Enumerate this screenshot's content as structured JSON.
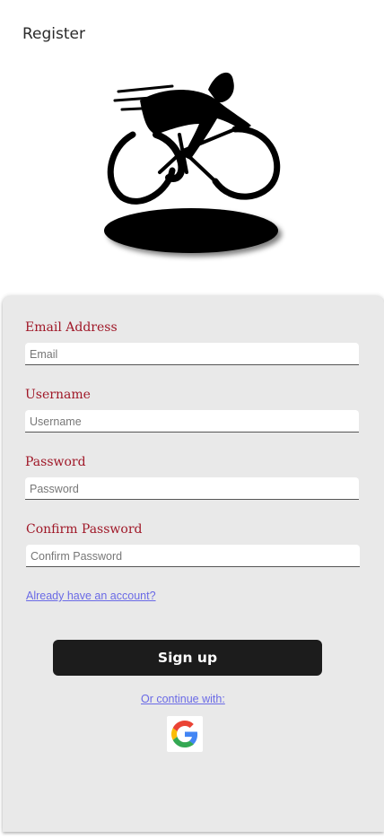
{
  "header": {
    "title": "Register"
  },
  "form": {
    "email": {
      "label": "Email Address",
      "placeholder": "Email",
      "value": ""
    },
    "username": {
      "label": "Username",
      "placeholder": "Username",
      "value": ""
    },
    "password": {
      "label": "Password",
      "placeholder": "Password",
      "value": ""
    },
    "confirm_password": {
      "label": "Confirm Password",
      "placeholder": "Confirm Password",
      "value": ""
    }
  },
  "links": {
    "have_account": "Already have an account?",
    "continue_with": "Or continue with:"
  },
  "buttons": {
    "signup": "Sign up"
  },
  "icons": {
    "logo": "cyclist-logo-icon",
    "google": "google-icon"
  },
  "colors": {
    "label": "#a01828",
    "link": "#6a6ae6",
    "button": "#1c1c1c",
    "card": "#e9e9e9"
  }
}
